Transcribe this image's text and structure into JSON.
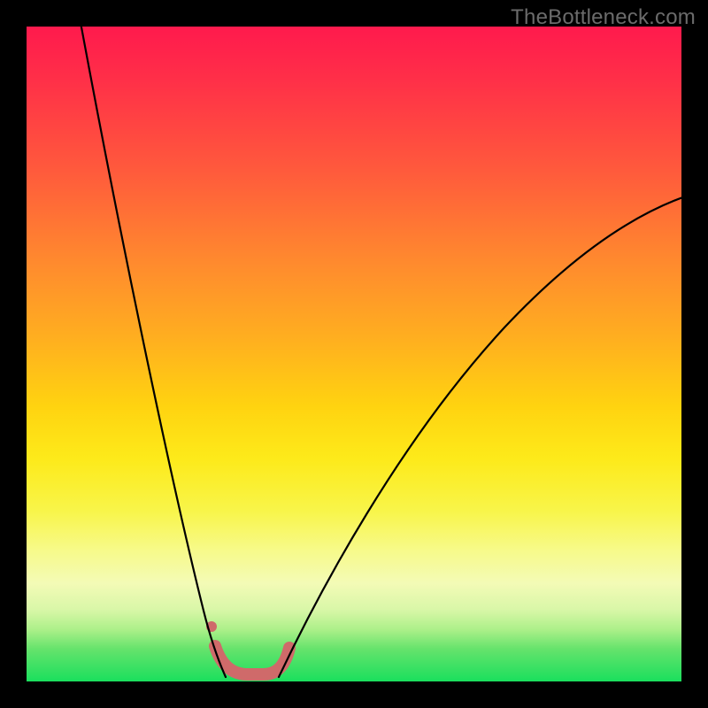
{
  "watermark": {
    "text": "TheBottleneck.com"
  },
  "chart_data": {
    "type": "line",
    "title": "",
    "xlabel": "",
    "ylabel": "",
    "xlim": [
      0,
      100
    ],
    "ylim": [
      0,
      100
    ],
    "background_gradient_stops": [
      {
        "pct": 0,
        "color": "#ff1a4d"
      },
      {
        "pct": 22,
        "color": "#ff5a3c"
      },
      {
        "pct": 48,
        "color": "#ffb01f"
      },
      {
        "pct": 66,
        "color": "#fdea1a"
      },
      {
        "pct": 85,
        "color": "#f3fbb6"
      },
      {
        "pct": 95,
        "color": "#66e36c"
      },
      {
        "pct": 100,
        "color": "#1adf5d"
      }
    ],
    "series": [
      {
        "name": "left-curve",
        "type": "line",
        "color": "#000000",
        "values": [
          {
            "x": 8,
            "y": 100
          },
          {
            "x": 11,
            "y": 90
          },
          {
            "x": 14,
            "y": 78
          },
          {
            "x": 17,
            "y": 64
          },
          {
            "x": 20,
            "y": 50
          },
          {
            "x": 23,
            "y": 36
          },
          {
            "x": 26,
            "y": 22
          },
          {
            "x": 28,
            "y": 12
          },
          {
            "x": 30,
            "y": 5
          }
        ]
      },
      {
        "name": "right-curve",
        "type": "line",
        "color": "#000000",
        "values": [
          {
            "x": 38,
            "y": 5
          },
          {
            "x": 42,
            "y": 12
          },
          {
            "x": 48,
            "y": 24
          },
          {
            "x": 56,
            "y": 38
          },
          {
            "x": 66,
            "y": 50
          },
          {
            "x": 78,
            "y": 60
          },
          {
            "x": 90,
            "y": 68
          },
          {
            "x": 100,
            "y": 74
          }
        ]
      },
      {
        "name": "valley-floor-highlight",
        "type": "line",
        "color": "#d46a6a",
        "stroke_width_px": 12,
        "values": [
          {
            "x": 29,
            "y": 5
          },
          {
            "x": 30,
            "y": 2.5
          },
          {
            "x": 33,
            "y": 1.5
          },
          {
            "x": 36,
            "y": 1.5
          },
          {
            "x": 38,
            "y": 2.5
          },
          {
            "x": 39,
            "y": 5
          }
        ]
      },
      {
        "name": "valley-dot",
        "type": "scatter",
        "color": "#d46a6a",
        "values": [
          {
            "x": 28.5,
            "y": 9
          }
        ]
      }
    ]
  }
}
